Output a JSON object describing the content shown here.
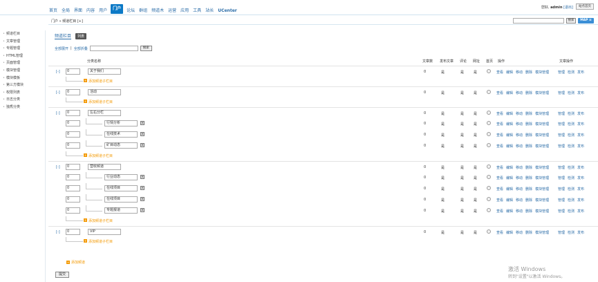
{
  "topnav": [
    "首页",
    "全局",
    "界面",
    "内容",
    "用户",
    "门户",
    "论坛",
    "群组",
    "频道木",
    "运营",
    "应用",
    "工具",
    "站长",
    "UCenter"
  ],
  "active_index": 5,
  "user": {
    "prefix": "您好,",
    "name": "admin",
    "logout": "[退出]",
    "site_home": "站点首页"
  },
  "breadcrumb": "门户 » 频道栏目 [+]",
  "search_button": "搜索",
  "map_button": "MAP ≡",
  "sidebar": [
    "频道栏目",
    "文章管理",
    "专题管理",
    "HTML管理",
    "页面管理",
    "模块管理",
    "模块模板",
    "第三方模块",
    "权限列表",
    "日志分类",
    "独秀分类"
  ],
  "tabs": {
    "tab1": "频道栏目",
    "tab2": "列表"
  },
  "filter": {
    "expand_all": "全部展开",
    "sep": "|",
    "collapse_all": "全部折叠",
    "button": "搜索"
  },
  "headers": {
    "name": "分类名称",
    "articles": "文章数",
    "publish": "发布文章",
    "comment": "评论",
    "domain": "网址",
    "homepage": "首页",
    "ops": "操作",
    "article_ops": "文章操作"
  },
  "ops_labels": [
    "查看",
    "编辑",
    "移动",
    "删除",
    "模块管理"
  ],
  "article_ops_labels": [
    "管理",
    "检测",
    "发布"
  ],
  "add_child_label": "添加频道子栏目",
  "add_top_label": "添加频道",
  "submit_label": "提交",
  "rows": [
    {
      "type": "top",
      "toggle": "[-]",
      "order": "0",
      "name": "关于我们",
      "count": "0",
      "publish": "是",
      "comment": "是",
      "domain": "是"
    },
    {
      "type": "add"
    },
    {
      "type": "top",
      "toggle": "[-]",
      "order": "0",
      "name": "活动",
      "count": "0",
      "publish": "是",
      "comment": "是",
      "domain": "是"
    },
    {
      "type": "add"
    },
    {
      "type": "top",
      "toggle": "[-]",
      "order": "0",
      "name": "左右分栏",
      "count": "0",
      "publish": "是",
      "comment": "是",
      "domain": "是"
    },
    {
      "type": "child",
      "order": "0",
      "name": "行情分析",
      "count": "0",
      "publish": "是",
      "comment": "是",
      "domain": "是"
    },
    {
      "type": "child",
      "order": "0",
      "name": "在线技术",
      "count": "0",
      "publish": "是",
      "comment": "是",
      "domain": "是"
    },
    {
      "type": "child",
      "order": "0",
      "name": "矿目动态",
      "count": "0",
      "publish": "是",
      "comment": "是",
      "domain": "是"
    },
    {
      "type": "add"
    },
    {
      "type": "top",
      "toggle": "[-]",
      "order": "0",
      "name": "营收频道",
      "count": "0",
      "publish": "是",
      "comment": "是",
      "domain": "是"
    },
    {
      "type": "child",
      "order": "0",
      "name": "行业动态",
      "count": "0",
      "publish": "是",
      "comment": "是",
      "domain": "是"
    },
    {
      "type": "child",
      "order": "0",
      "name": "在线项目",
      "count": "0",
      "publish": "是",
      "comment": "是",
      "domain": "是"
    },
    {
      "type": "child",
      "order": "0",
      "name": "在线项目",
      "count": "0",
      "publish": "是",
      "comment": "是",
      "domain": "是"
    },
    {
      "type": "child",
      "order": "0",
      "name": "专题报道",
      "count": "0",
      "publish": "是",
      "comment": "是",
      "domain": "是"
    },
    {
      "type": "add"
    },
    {
      "type": "top",
      "toggle": "[-]",
      "order": "0",
      "name": "VIP",
      "count": "0",
      "publish": "是",
      "comment": "是",
      "domain": "是"
    },
    {
      "type": "add"
    }
  ],
  "watermark": {
    "line1": "激活 Windows",
    "line2": "转到\"设置\"以激活 Windows。"
  }
}
